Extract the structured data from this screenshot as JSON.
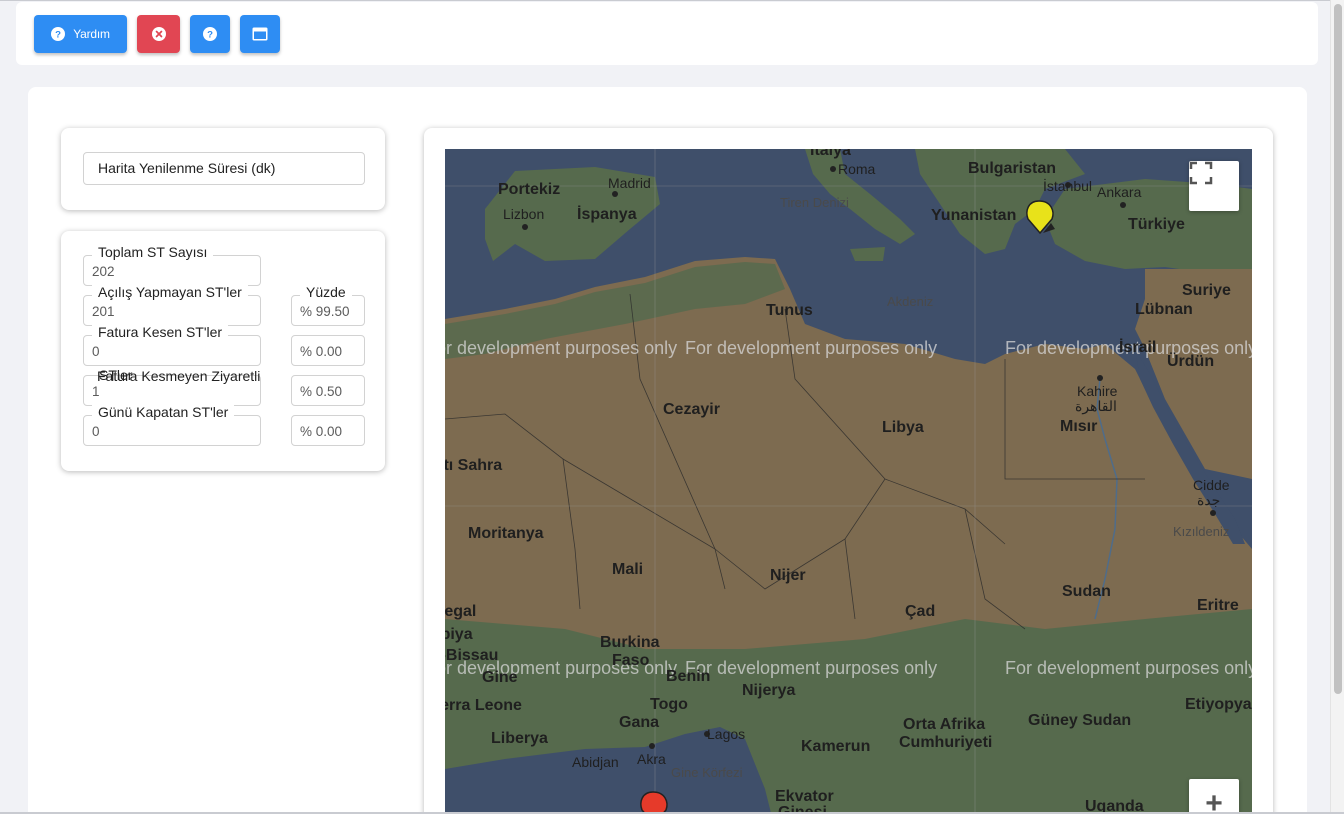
{
  "toolbar": {
    "help_button_label": "Yardım",
    "help_icon": "question-circle-icon",
    "close_icon": "x-circle-icon",
    "info_icon": "question-circle-icon",
    "window_icon": "window-icon",
    "colors": {
      "primary": "#2e8df3",
      "danger": "#e14653"
    }
  },
  "settings_card": {
    "refresh_label": "Harita Yenilenme Süresi (dk)"
  },
  "stats": {
    "percent_header": "Yüzde",
    "rows": [
      {
        "label": "Toplam ST Sayısı",
        "value": "202",
        "percent": ""
      },
      {
        "label": "Açılış Yapmayan ST'ler",
        "value": "201",
        "percent": "% 99.50"
      },
      {
        "label": "Fatura Kesen ST'ler",
        "value": "0",
        "percent": "% 0.00"
      },
      {
        "label": "Fatura Kesmeyen Ziyaretli",
        "label_overlap": "STler",
        "value": "1",
        "percent": "% 0.50"
      },
      {
        "label": "Günü Kapatan ST'ler",
        "value": "0",
        "percent": "% 0.00"
      }
    ]
  },
  "map": {
    "watermark": "For development purposes only",
    "fullscreen_icon": "fullscreen-icon",
    "zoom_in_label": "+",
    "markers": [
      {
        "name": "yellow-marker",
        "color": "#e8e21a"
      },
      {
        "name": "red-marker",
        "color": "#e63a2a"
      }
    ],
    "colors": {
      "sea": "#3f4f6a",
      "land": "#7d6b50",
      "vegetation": "#566a4d"
    },
    "labels": {
      "italya": "İtalya",
      "roma": "Roma",
      "bulgaristan": "Bulgaristan",
      "portekiz": "Portekiz",
      "madrid": "Madrid",
      "ispanya": "İspanya",
      "lizbon": "Lizbon",
      "tiren": "Tiren Denizi",
      "yunanistan": "Yunanistan",
      "istanbul": "İstanbul",
      "ankara": "Ankara",
      "turkiye": "Türkiye",
      "tunus": "Tunus",
      "akdeniz": "Akdeniz",
      "suriye": "Suriye",
      "lubnan": "Lübnan",
      "israil": "İsrail",
      "urdun": "Ürdün",
      "cezayir": "Cezayir",
      "libya": "Libya",
      "kahire": "Kahire",
      "kahire_ar": "القاهرة",
      "misir": "Mısır",
      "bati_sahra": "Batı Sahra",
      "cidde": "Cidde",
      "cidde_ar": "جدة",
      "kizildeniz": "Kızıldeniz",
      "moritanya": "Moritanya",
      "mali": "Mali",
      "nijer": "Nijer",
      "sudan": "Sudan",
      "senegal": "Senegal",
      "cad": "Çad",
      "eritre": "Eritre",
      "gambiya": "Gambiya",
      "gine_bissau": "Gine-Bissau",
      "burkina": "Burkina",
      "faso": "Faso",
      "gine": "Gine",
      "benin": "Benin",
      "nijerya": "Nijerya",
      "sierra_leone": "Sierra Leone",
      "togo": "Togo",
      "gana": "Gana",
      "lagos": "Lagos",
      "orta_afrika": "Orta Afrika",
      "cumhuriyeti": "Cumhuriyeti",
      "guney_sudan": "Güney Sudan",
      "etiyopya": "Etiyopya",
      "liberya": "Liberya",
      "abidjan": "Abidjan",
      "akra": "Akra",
      "kamerun": "Kamerun",
      "gine_korfezi": "Gine Körfezi",
      "ekvator": "Ekvator",
      "ginesi": "Ginesi",
      "uganda": "Uganda"
    }
  }
}
